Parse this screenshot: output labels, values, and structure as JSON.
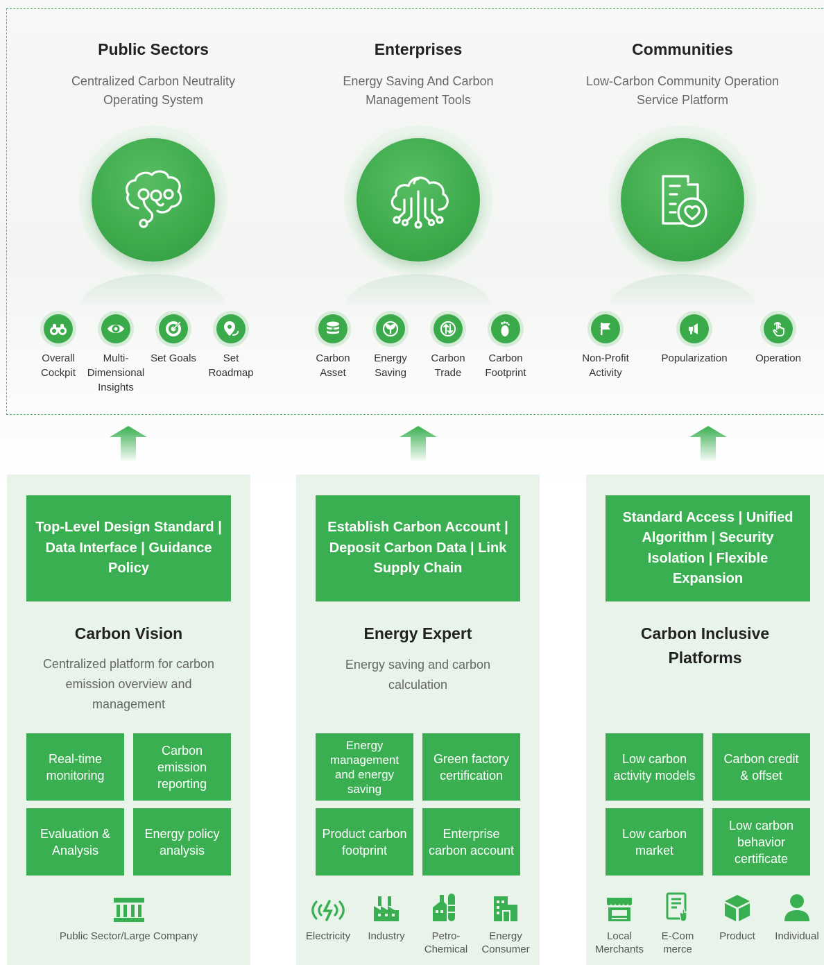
{
  "top_columns": [
    {
      "title": "Public Sectors",
      "subtitle": "Centralized Carbon Neutrality Operating System",
      "main_icon": "brain-icon",
      "features": [
        {
          "label": "Overall Cockpit",
          "icon": "binoculars-icon"
        },
        {
          "label": "Multi-Dimensional Insights",
          "icon": "eye-icon"
        },
        {
          "label": "Set Goals",
          "icon": "target-icon"
        },
        {
          "label": "Set Roadmap",
          "icon": "map-pin-icon"
        }
      ]
    },
    {
      "title": "Enterprises",
      "subtitle": "Energy Saving And Carbon Management Tools",
      "main_icon": "cloud-circuit-icon",
      "features": [
        {
          "label": "Carbon Asset",
          "icon": "coin-stack-icon"
        },
        {
          "label": "Energy Saving",
          "icon": "leaf-icon"
        },
        {
          "label": "Carbon Trade",
          "icon": "exchange-icon"
        },
        {
          "label": "Carbon Footprint",
          "icon": "footprint-icon"
        }
      ]
    },
    {
      "title": "Communities",
      "subtitle": "Low-Carbon Community Operation Service Platform",
      "main_icon": "building-heart-icon",
      "features": [
        {
          "label": "Non-Profit Activity",
          "icon": "flag-icon"
        },
        {
          "label": "Popularization",
          "icon": "megaphone-icon"
        },
        {
          "label": "Operation",
          "icon": "hand-pointer-icon"
        }
      ]
    }
  ],
  "panels": [
    {
      "banner": "Top-Level Design Standard | Data Interface | Guidance Policy",
      "title": "Carbon Vision",
      "description": "Centralized platform for carbon emission overview and management",
      "cells": [
        "Real-time monitoring",
        "Carbon emission reporting",
        "Evaluation & Analysis",
        "Energy policy analysis"
      ],
      "bottom": [
        {
          "label": "Public Sector/Large Company",
          "icon": "government-building-icon"
        }
      ]
    },
    {
      "banner": "Establish Carbon Account | Deposit Carbon Data | Link Supply Chain",
      "title": "Energy Expert",
      "description": "Energy saving and carbon calculation",
      "cells": [
        "Energy management and energy saving",
        "Green factory certification",
        "Product carbon footprint",
        "Enterprise carbon account"
      ],
      "bottom": [
        {
          "label": "Electricity",
          "icon": "electricity-icon"
        },
        {
          "label": "Industry",
          "icon": "factory-icon"
        },
        {
          "label": "Petro-Chemical",
          "icon": "petrochemical-icon"
        },
        {
          "label": "Energy Consumer",
          "icon": "office-building-icon"
        }
      ]
    },
    {
      "banner": "Standard Access | Unified Algorithm | Security Isolation | Flexible Expansion",
      "title": "Carbon Inclusive Platforms",
      "description": "",
      "cells": [
        "Low carbon activity models",
        "Carbon credit & offset",
        "Low carbon market",
        "Low carbon behavior certificate"
      ],
      "bottom": [
        {
          "label": "Local Merchants",
          "icon": "storefront-icon"
        },
        {
          "label": "E-Com merce",
          "icon": "tablet-touch-icon"
        },
        {
          "label": "Product",
          "icon": "box-icon"
        },
        {
          "label": "Individual",
          "icon": "person-icon"
        }
      ]
    }
  ],
  "colors": {
    "primary_green": "#3aaf51",
    "panel_bg": "#e8f3ea",
    "frame_dash": "#5bbf6a"
  }
}
